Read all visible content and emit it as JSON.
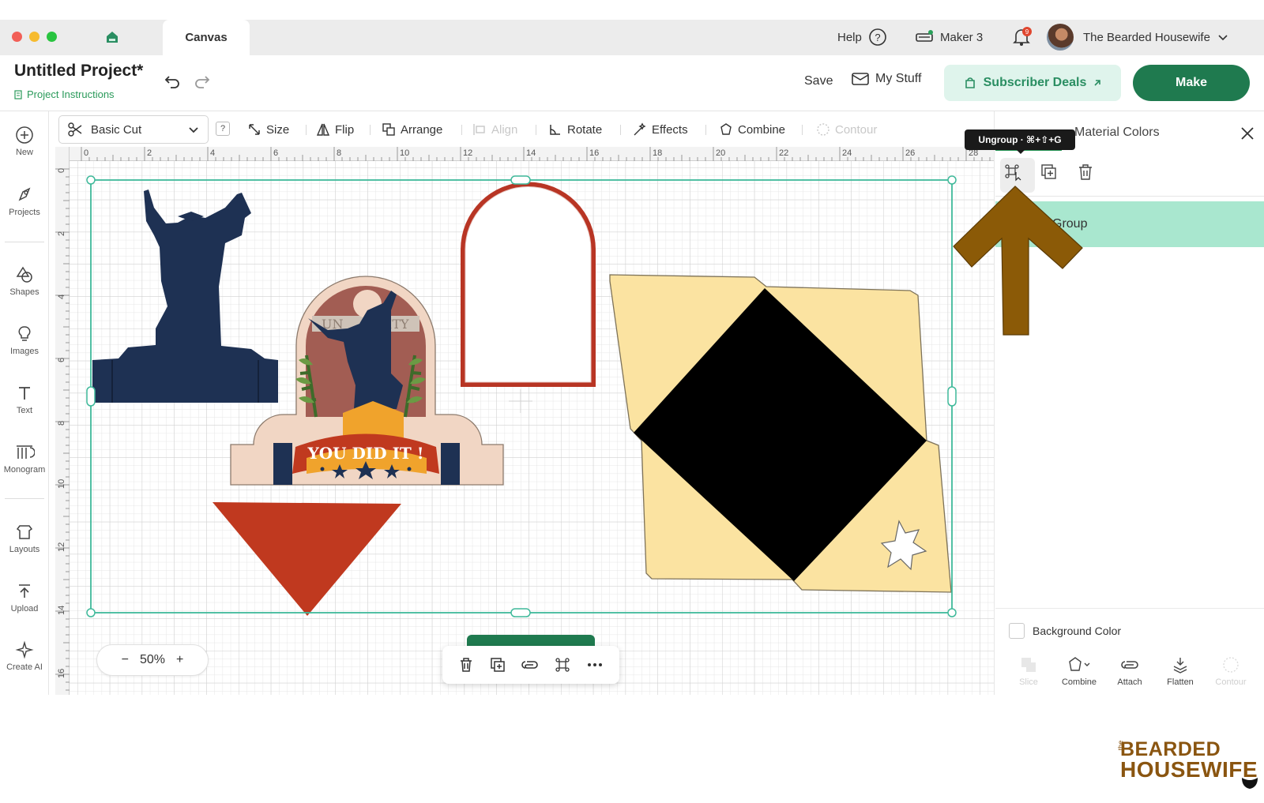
{
  "titlebar": {
    "tab_label": "Canvas",
    "help_label": "Help",
    "machine_label": "Maker 3",
    "notification_count": "9",
    "user_name": "The Bearded Housewife"
  },
  "header": {
    "project_title": "Untitled Project*",
    "project_instructions": "Project Instructions",
    "save_label": "Save",
    "mystuff_label": "My Stuff",
    "deals_label": "Subscriber Deals",
    "make_label": "Make"
  },
  "leftnav": {
    "items": [
      {
        "label": "New",
        "icon": "plus-circle-icon"
      },
      {
        "label": "Projects",
        "icon": "projects-icon"
      },
      {
        "label": "Shapes",
        "icon": "shapes-icon"
      },
      {
        "label": "Images",
        "icon": "lightbulb-icon"
      },
      {
        "label": "Text",
        "icon": "text-icon"
      },
      {
        "label": "Monogram",
        "icon": "monogram-icon"
      },
      {
        "label": "Layouts",
        "icon": "layouts-icon"
      },
      {
        "label": "Upload",
        "icon": "upload-icon"
      },
      {
        "label": "Create AI",
        "icon": "sparkle-icon"
      }
    ]
  },
  "toolbar": {
    "operation": "Basic Cut",
    "help": "?",
    "size": "Size",
    "flip": "Flip",
    "arrange": "Arrange",
    "align": "Align",
    "rotate": "Rotate",
    "effects": "Effects",
    "combine": "Combine",
    "contour": "Contour"
  },
  "ruler": {
    "top": [
      "0",
      "2",
      "4",
      "6",
      "8",
      "10",
      "12",
      "14",
      "16",
      "18",
      "20",
      "22",
      "24",
      "26",
      "28"
    ],
    "left": [
      "0",
      "2",
      "4",
      "6",
      "8",
      "10",
      "12",
      "14",
      "16"
    ]
  },
  "canvas": {
    "banner_text": "YOU DID IT !",
    "univ_text_left": "UN",
    "univ_text_right": "ITY"
  },
  "zoom": {
    "minus": "−",
    "value": "50%",
    "plus": "+"
  },
  "rightpanel": {
    "title": "Material Colors",
    "tooltip": "Ungroup · ⌘+⇧+G",
    "layer_label": "Group",
    "background_label": "Background Color",
    "actions": [
      {
        "label": "Slice",
        "enabled": false
      },
      {
        "label": "Combine",
        "enabled": true
      },
      {
        "label": "Attach",
        "enabled": true
      },
      {
        "label": "Flatten",
        "enabled": true
      },
      {
        "label": "Contour",
        "enabled": false
      }
    ]
  },
  "brand": {
    "the": "the",
    "line1": "BEARDED",
    "line2": "HOUSEWIFE"
  },
  "colors": {
    "accent_green": "#1f7a4f",
    "selection_teal": "#3fb99a",
    "navy": "#1e3153",
    "red": "#c0391f",
    "cream": "#fbe3a1",
    "arrow_brown": "#8b5a07"
  }
}
